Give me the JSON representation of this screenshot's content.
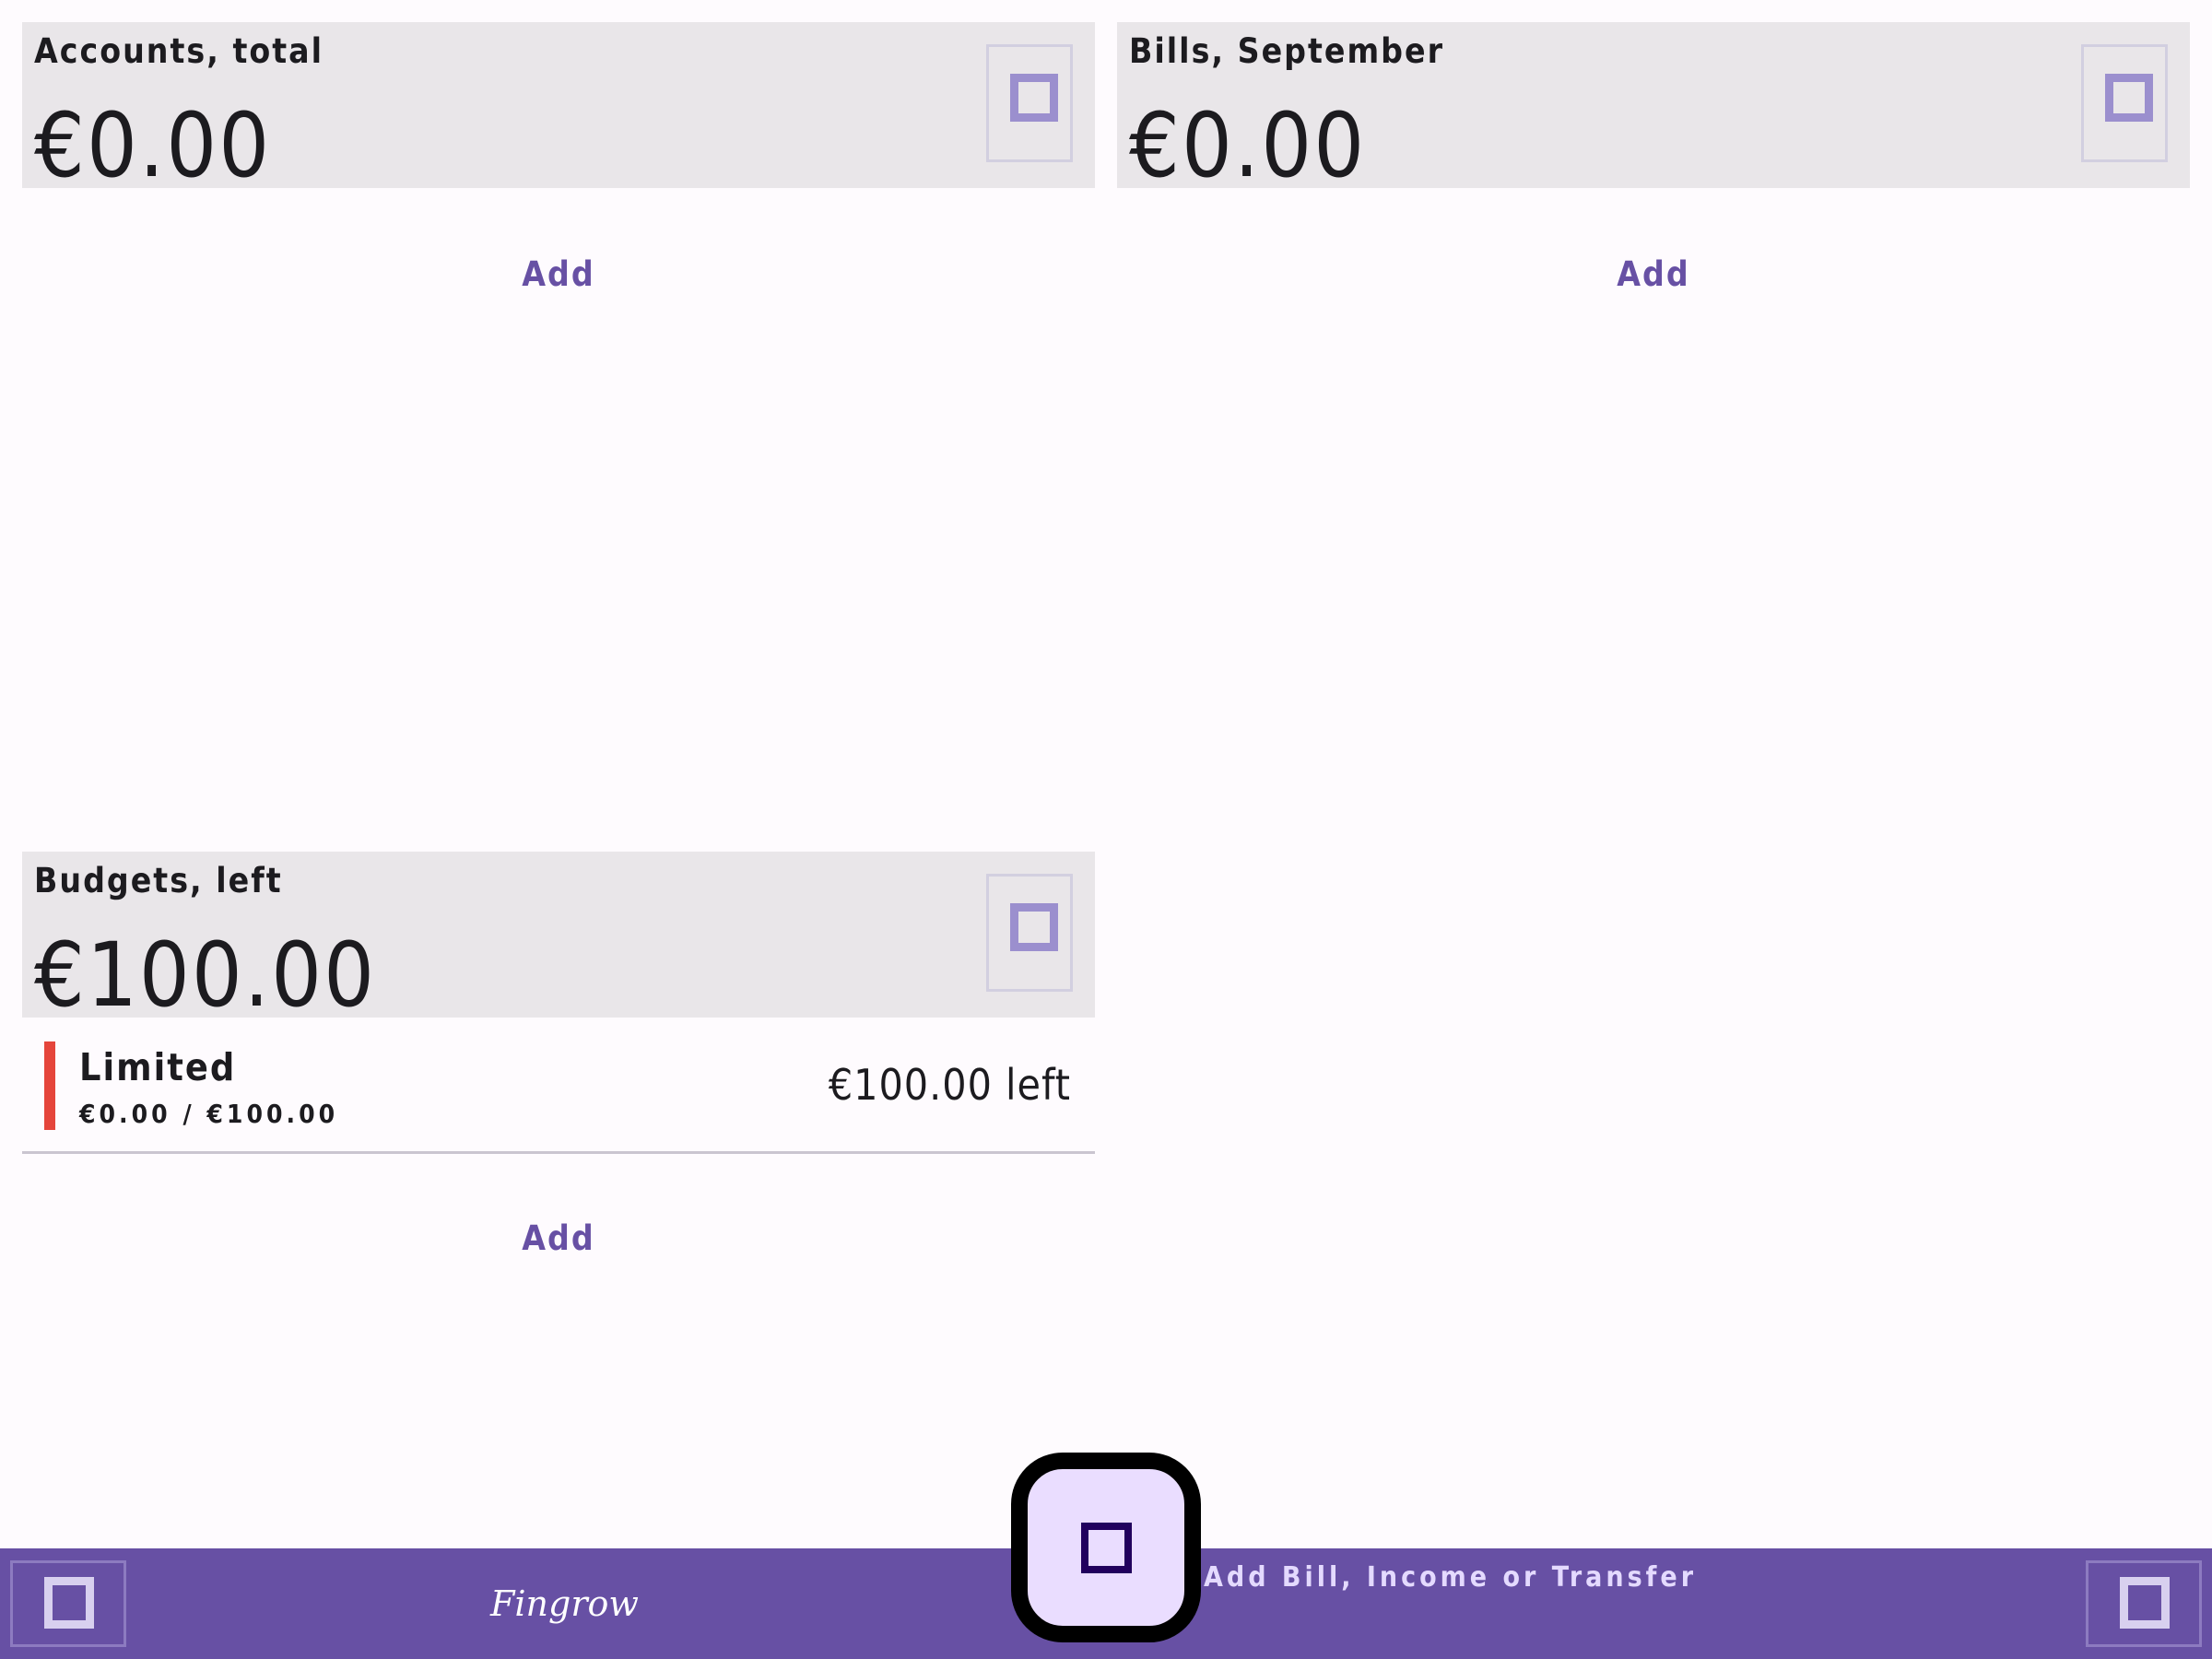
{
  "accounts": {
    "title": "Accounts, total",
    "amount": "€0.00",
    "add_label": "Add"
  },
  "bills": {
    "title": "Bills, September",
    "amount": "€0.00",
    "add_label": "Add"
  },
  "budgets": {
    "title": "Budgets, left",
    "amount": "€100.00",
    "add_label": "Add",
    "items": [
      {
        "name": "Limited",
        "progress": "€0.00 / €100.00",
        "left": "€100.00 left",
        "color": "#e5453b"
      }
    ]
  },
  "bottom_bar": {
    "logo": "Fingrow",
    "fab_label": "Add Bill, Income or Transfer"
  },
  "colors": {
    "accent": "#6750a4",
    "header_bg": "#e9e6e9",
    "fab_bg": "#eaddff",
    "budget_indicator": "#e5453b"
  },
  "icons": {
    "header_action": "square-icon",
    "nav_left": "square-icon",
    "nav_right": "square-icon",
    "fab": "square-icon"
  }
}
